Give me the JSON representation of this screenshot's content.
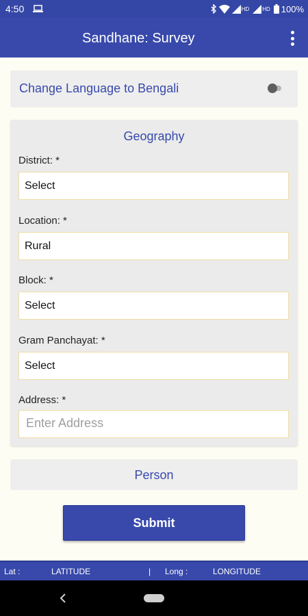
{
  "status_bar": {
    "time": "4:50",
    "hd_1": "HD",
    "hd_2": "HD",
    "battery": "100%"
  },
  "app_bar": {
    "title": "Sandhane: Survey"
  },
  "language_card": {
    "label": "Change Language to Bengali",
    "toggle_on": false
  },
  "geography": {
    "title": "Geography",
    "fields": [
      {
        "label": "District: *",
        "value": "Select"
      },
      {
        "label": "Location: *",
        "value": "Rural"
      },
      {
        "label": "Block: *",
        "value": "Select"
      },
      {
        "label": "Gram Panchayat: *",
        "value": "Select"
      },
      {
        "label": "Address: *",
        "placeholder": "Enter Address"
      }
    ]
  },
  "person": {
    "title": "Person"
  },
  "submit_label": "Submit",
  "coords": {
    "lat_label": "Lat :",
    "lat_value": "LATITUDE",
    "separator": "|",
    "long_label": "Long :",
    "long_value": "LONGITUDE"
  },
  "icons": {
    "status": [
      "laptop-icon",
      "bluetooth-icon",
      "wifi-icon",
      "signal-icon",
      "battery-icon"
    ],
    "app_bar": [
      "overflow-menu-icon"
    ],
    "nav": [
      "back-icon",
      "home-pill-icon"
    ]
  },
  "colors": {
    "primary": "#3849ab",
    "status_bar": "#3547a6",
    "field_border": "#f0dca4",
    "card_bg": "#ebebeb"
  }
}
